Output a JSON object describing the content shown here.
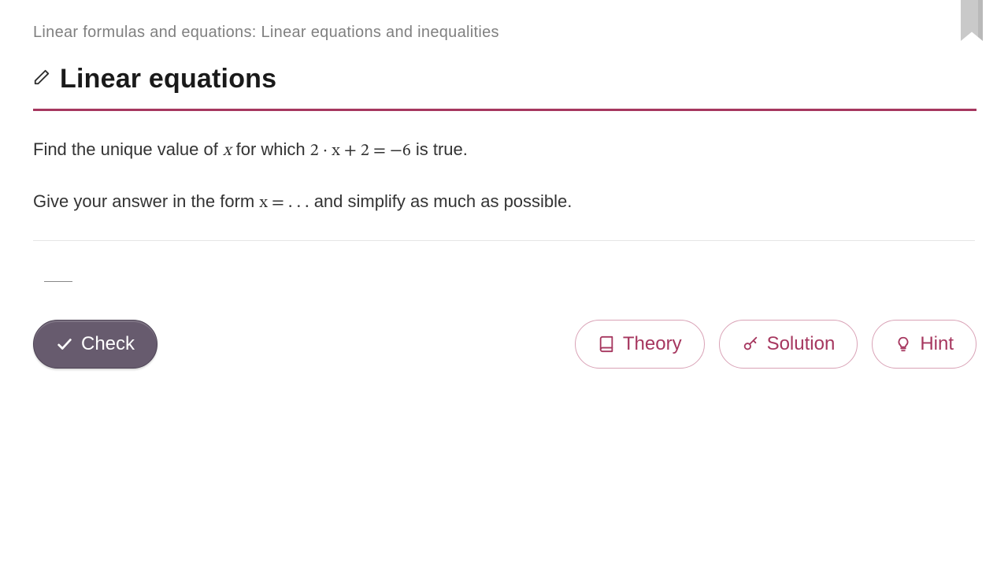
{
  "breadcrumb": "Linear formulas and equations: Linear equations and inequalities",
  "title": "Linear equations",
  "question": {
    "line1_pre": "Find the unique value of ",
    "line1_var": "x",
    "line1_mid": " for which ",
    "equation": "2 · x + 2 = −6",
    "line1_post": " is true.",
    "line2_pre": "Give your answer in the form ",
    "line2_form": "x = . . .",
    "line2_post": " and simplify as much as possible."
  },
  "buttons": {
    "check": "Check",
    "theory": "Theory",
    "solution": "Solution",
    "hint": "Hint"
  }
}
